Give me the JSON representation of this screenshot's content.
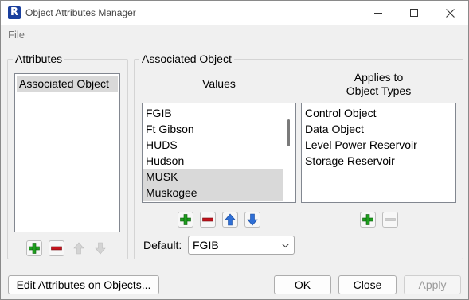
{
  "window": {
    "title": "Object Attributes Manager",
    "controls": [
      "minimize-icon",
      "maximize-icon",
      "close-icon"
    ]
  },
  "menu": {
    "file": "File"
  },
  "attributes_panel": {
    "title": "Attributes",
    "items": [
      {
        "label": "Associated Object",
        "selected": true
      }
    ],
    "buttons": [
      {
        "icon": "plus-icon",
        "enabled": true
      },
      {
        "icon": "minus-icon",
        "enabled": true
      },
      {
        "icon": "arrow-up-icon",
        "enabled": false
      },
      {
        "icon": "arrow-down-icon",
        "enabled": false
      }
    ]
  },
  "associated_panel": {
    "title": "Associated Object",
    "values_header": "Values",
    "applies_header": "Applies to\nObject Types",
    "values": [
      {
        "label": "FGIB",
        "selected": false
      },
      {
        "label": "Ft Gibson",
        "selected": false
      },
      {
        "label": "HUDS",
        "selected": false
      },
      {
        "label": "Hudson",
        "selected": false
      },
      {
        "label": "MUSK",
        "selected": true
      },
      {
        "label": "Muskogee",
        "selected": true
      }
    ],
    "object_types": [
      {
        "label": "Control Object"
      },
      {
        "label": "Data Object"
      },
      {
        "label": "Level Power Reservoir"
      },
      {
        "label": "Storage Reservoir"
      }
    ],
    "default_label": "Default:",
    "default_value": "FGIB"
  },
  "footer": {
    "edit_button": "Edit Attributes on Objects...",
    "ok_button": "OK",
    "close_button": "Close",
    "apply_button": "Apply"
  },
  "colors": {
    "green_plus": "#1e9e1e",
    "red_minus": "#c4121b",
    "blue_arrow": "#2f6fd6",
    "disabled_arrow": "#c7c7c7",
    "selection": "#d9d9d9"
  }
}
